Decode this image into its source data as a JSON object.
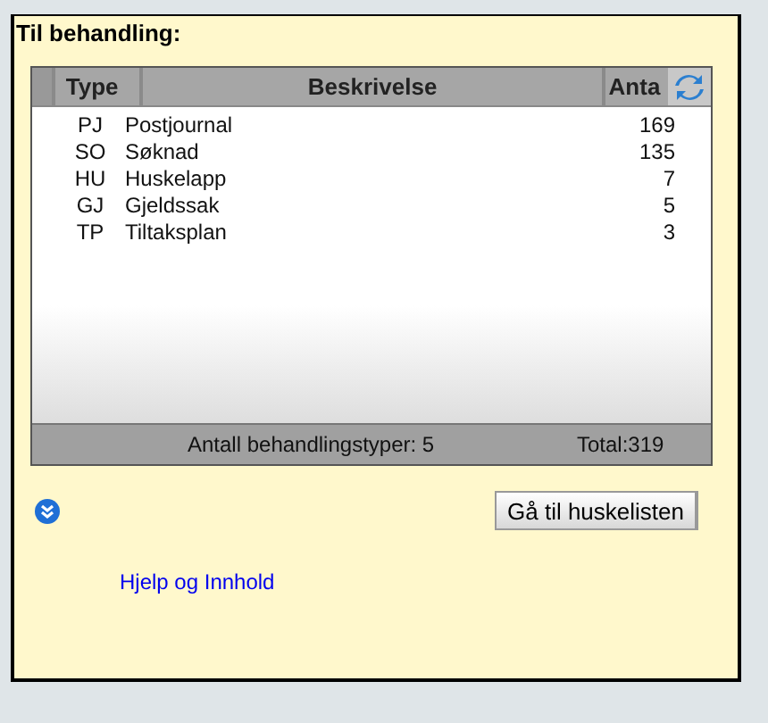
{
  "panel": {
    "title": "Til behandling:"
  },
  "table": {
    "columns": [
      "Type",
      "Beskrivelse",
      "Anta"
    ],
    "rows": [
      {
        "type": "PJ",
        "description": "Postjournal",
        "count": "169"
      },
      {
        "type": "SO",
        "description": "Søknad",
        "count": "135"
      },
      {
        "type": "HU",
        "description": "Huskelapp",
        "count": "7"
      },
      {
        "type": "GJ",
        "description": "Gjeldssak",
        "count": "5"
      },
      {
        "type": "TP",
        "description": "Tiltaksplan",
        "count": "3"
      }
    ],
    "footer": {
      "summary": "Antall behandlingstyper: 5",
      "total": "Total:319"
    }
  },
  "button": "Gå til huskelisten",
  "link": "Hjelp og Innhold"
}
